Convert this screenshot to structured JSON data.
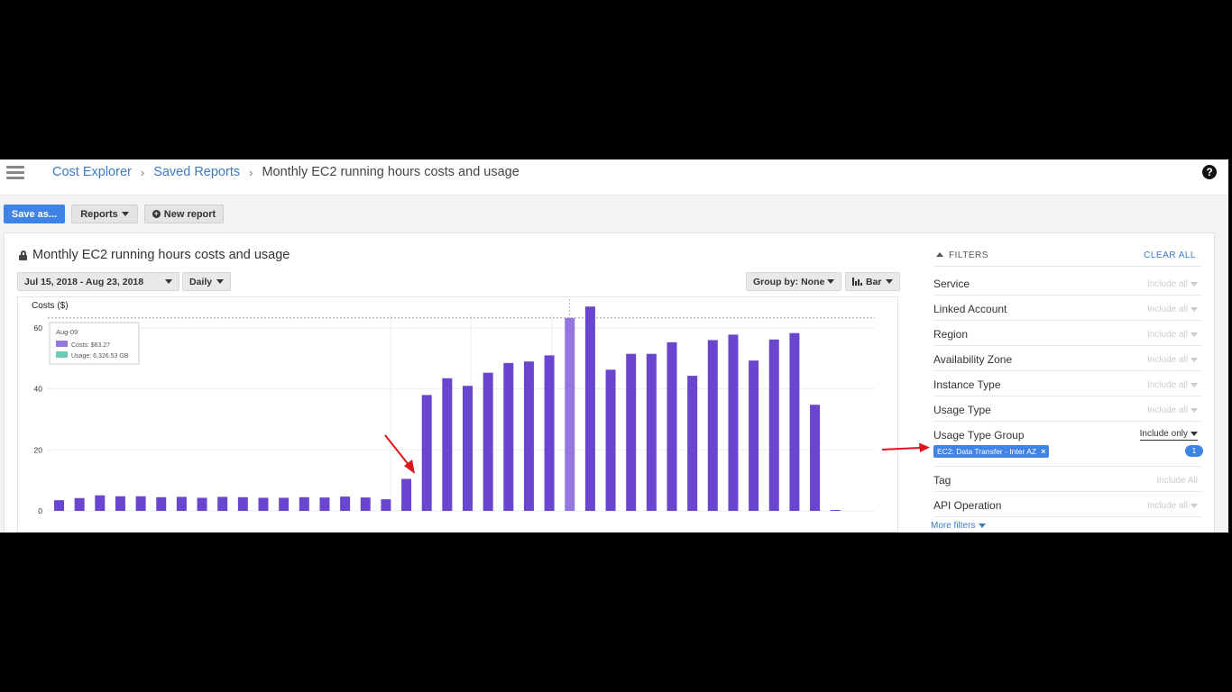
{
  "nav": {
    "crumb_1": "Cost Explorer",
    "crumb_2": "Saved Reports",
    "crumb_current": "Monthly EC2 running hours costs and usage",
    "separator": "›",
    "help": "?"
  },
  "toolbar": {
    "save_label": "Save as...",
    "reports_label": "Reports",
    "new_report_label": "New report"
  },
  "report": {
    "title": "Monthly EC2 running hours costs and usage",
    "date_range": "Jul 15, 2018 - Aug 23, 2018",
    "granularity": "Daily",
    "group_by": "Group by: None",
    "chart_type": "Bar"
  },
  "tooltip": {
    "date": "Aug-09",
    "costs": "Costs: $63.27",
    "usage": "Usage: 6,326.53 GB"
  },
  "colors": {
    "bar": "#6a46d0",
    "bar_highlight": "#9478df",
    "usage": "#6fc9b4",
    "accent": "#3f83e4",
    "arrow": "#e0141b"
  },
  "filters": {
    "heading": "FILTERS",
    "clear_all": "CLEAR ALL",
    "rows": [
      {
        "label": "Service",
        "value": "Include all"
      },
      {
        "label": "Linked Account",
        "value": "Include all"
      },
      {
        "label": "Region",
        "value": "Include all"
      },
      {
        "label": "Availability Zone",
        "value": "Include all"
      },
      {
        "label": "Instance Type",
        "value": "Include all"
      },
      {
        "label": "Usage Type",
        "value": "Include all"
      },
      {
        "label": "Usage Type Group",
        "value": "Include only"
      },
      {
        "label": "Tag",
        "value": "Include All"
      },
      {
        "label": "API Operation",
        "value": "Include all"
      }
    ],
    "chip": "EC2: Data Transfer - Inter AZ",
    "chip_count": "1",
    "more": "More filters"
  },
  "chart_data": {
    "type": "bar",
    "ylabel": "Costs ($)",
    "ylim": [
      0,
      65
    ],
    "yticks": [
      0,
      20,
      40,
      60
    ],
    "highlight_index": 25,
    "reference_line": 63.27,
    "values": [
      3.5,
      4.2,
      5.1,
      4.8,
      4.8,
      4.5,
      4.6,
      4.3,
      4.6,
      4.5,
      4.3,
      4.3,
      4.5,
      4.4,
      4.7,
      4.4,
      3.8,
      10.5,
      38,
      43.5,
      41,
      45.3,
      48.5,
      49,
      51,
      63.27,
      67,
      46.3,
      51.5,
      51.5,
      55.3,
      44.3,
      56,
      57.8,
      49.3,
      56.2,
      58.3,
      34.8,
      0.3
    ]
  }
}
